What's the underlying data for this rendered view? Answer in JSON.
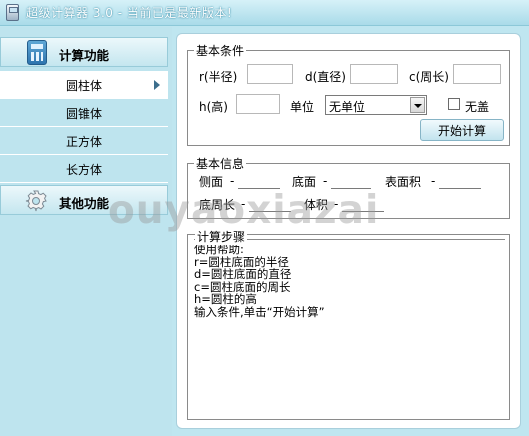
{
  "window": {
    "title": "超级计算器 3.0 - 当前已是最新版本!"
  },
  "sidebar": {
    "sections": [
      {
        "label": "计算功能",
        "icon": "calculator-icon"
      },
      {
        "label": "其他功能",
        "icon": "gear-icon"
      }
    ],
    "items": [
      {
        "label": "圆柱体",
        "active": true
      },
      {
        "label": "圆锥体",
        "active": false
      },
      {
        "label": "正方体",
        "active": false
      },
      {
        "label": "长方体",
        "active": false
      }
    ]
  },
  "basic_conditions": {
    "legend": "基本条件",
    "radius_label": "r(半径)",
    "diameter_label": "d(直径)",
    "circumference_label": "c(周长)",
    "height_label": "h(高)",
    "unit_label": "单位",
    "unit_value": "无单位",
    "no_lid_label": "无盖",
    "start_button": "开始计算"
  },
  "basic_info": {
    "legend": "基本信息",
    "side_label": "侧面",
    "side_value": "-",
    "base_label": "底面",
    "base_value": "-",
    "surface_label": "表面积",
    "surface_value": "-",
    "perimeter_label": "底周长",
    "perimeter_value": "-",
    "volume_label": "体积",
    "volume_value": "-"
  },
  "steps": {
    "legend": "计算步骤",
    "lines": [
      "使用帮助:",
      "r=圆柱底面的半径",
      "d=圆柱底面的直径",
      "c=圆柱底面的周长",
      "h=圆柱的高",
      "输入条件,单击“开始计算”"
    ]
  },
  "watermark": "ouyaoxiazai",
  "colors": {
    "accent": "#a9dbe9",
    "sidebar": "#bee4ee",
    "active_item": "#ffffff"
  }
}
